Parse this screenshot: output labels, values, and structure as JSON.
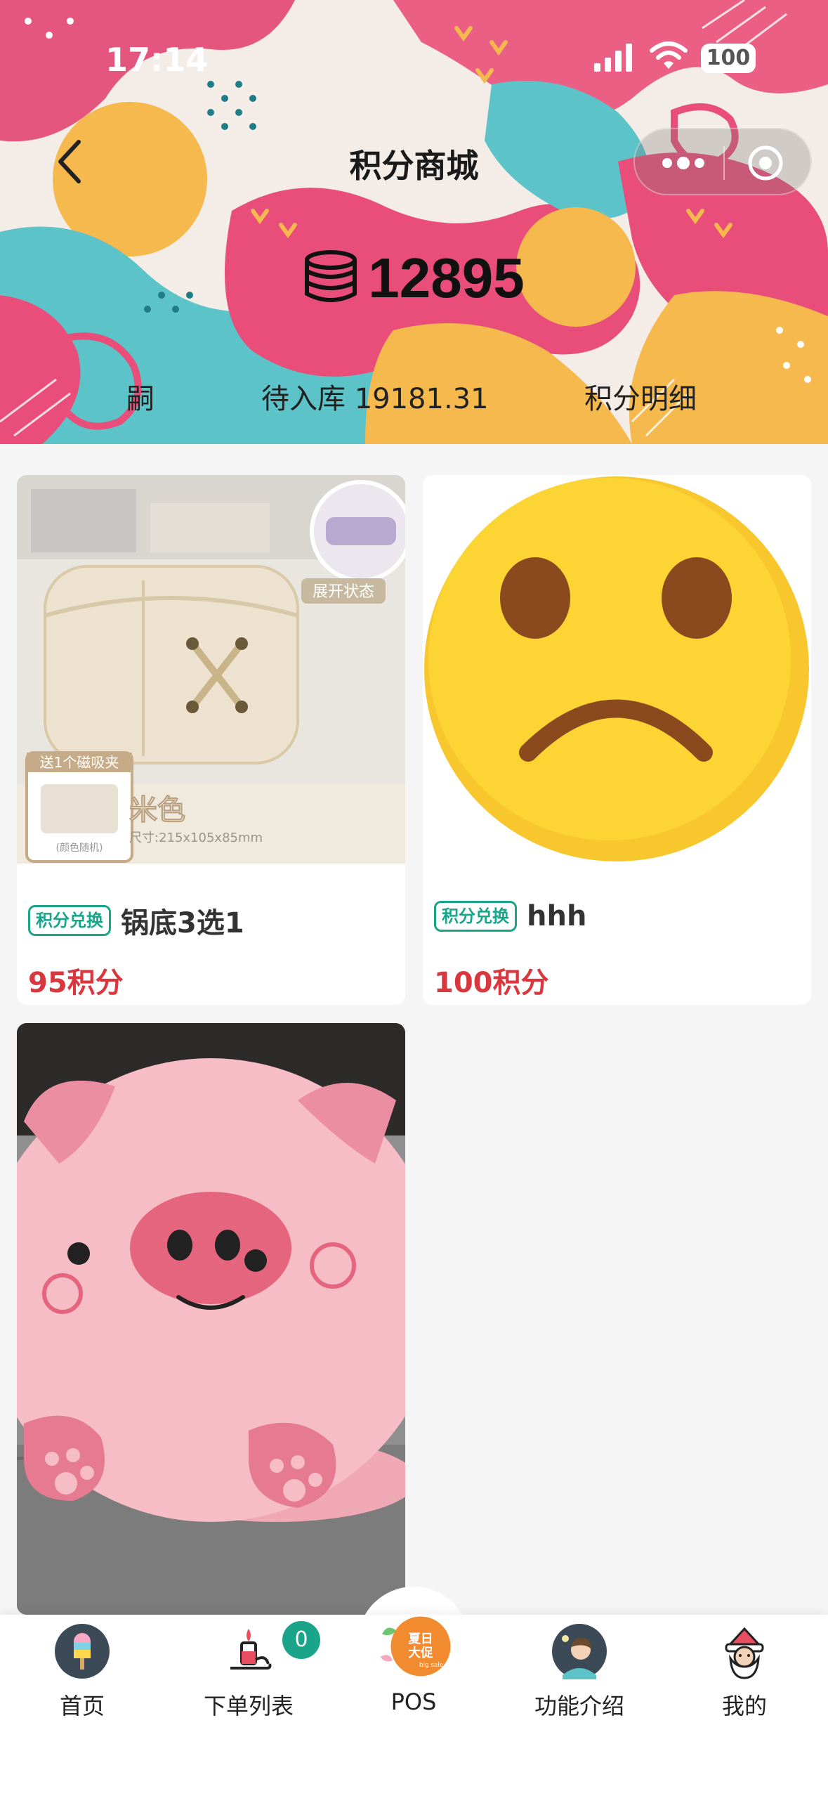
{
  "status_bar": {
    "time": "17:14",
    "battery": "100"
  },
  "nav": {
    "title": "积分商城"
  },
  "points": {
    "value": "12895"
  },
  "sub_nav": {
    "left_label": "嗣",
    "pending_label": "待入库 19181.31",
    "detail_label": "积分明细"
  },
  "products": [
    {
      "tag": "积分兑换",
      "name": "锅底3选1",
      "price": "95积分",
      "image_text": {
        "expanded": "展开状态",
        "gift": "送1个磁吸夹",
        "gift_note": "(颜色随机)",
        "color": "米色",
        "size": "尺寸:215x105x85mm"
      }
    },
    {
      "tag": "积分兑换",
      "name": "hhh",
      "price": "100积分"
    },
    {
      "tag": "",
      "name": "",
      "price": ""
    }
  ],
  "tabbar": {
    "home": "首页",
    "orders": "下单列表",
    "orders_badge": "0",
    "pos": "POS",
    "pos_logo_text": {
      "line1": "夏日",
      "line2": "大促",
      "line3": "big sale"
    },
    "features": "功能介绍",
    "mine": "我的"
  },
  "colors": {
    "accent_green": "#1aa58a",
    "price_red": "#d9363e",
    "tag_green": "#1aa58a"
  },
  "icons": [
    "back-chevron-icon",
    "more-dots-icon",
    "target-close-icon",
    "coins-stack-icon",
    "popsicle-icon",
    "candle-icon",
    "sale-badge-icon",
    "avatar-icon",
    "santa-icon"
  ]
}
